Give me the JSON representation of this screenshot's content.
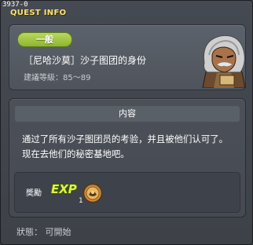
{
  "header": {
    "quest_id": "3937-0",
    "title": "QUEST INFO"
  },
  "quest": {
    "category": "一般",
    "name": "［尼哈沙莫］沙子图团的身份",
    "level": "建議等級：85～89"
  },
  "content": {
    "header": "内容",
    "text": "通过了所有沙子图团员的考验，并且被他们认可了。现在去他们的秘密基地吧。"
  },
  "reward": {
    "label": "奬勵",
    "exp_label": "EXP",
    "item_count": "1"
  },
  "status": {
    "text": "狀態：  可開始"
  },
  "colors": {
    "title": "#ffe36a",
    "category_bg": "#a6c944"
  }
}
